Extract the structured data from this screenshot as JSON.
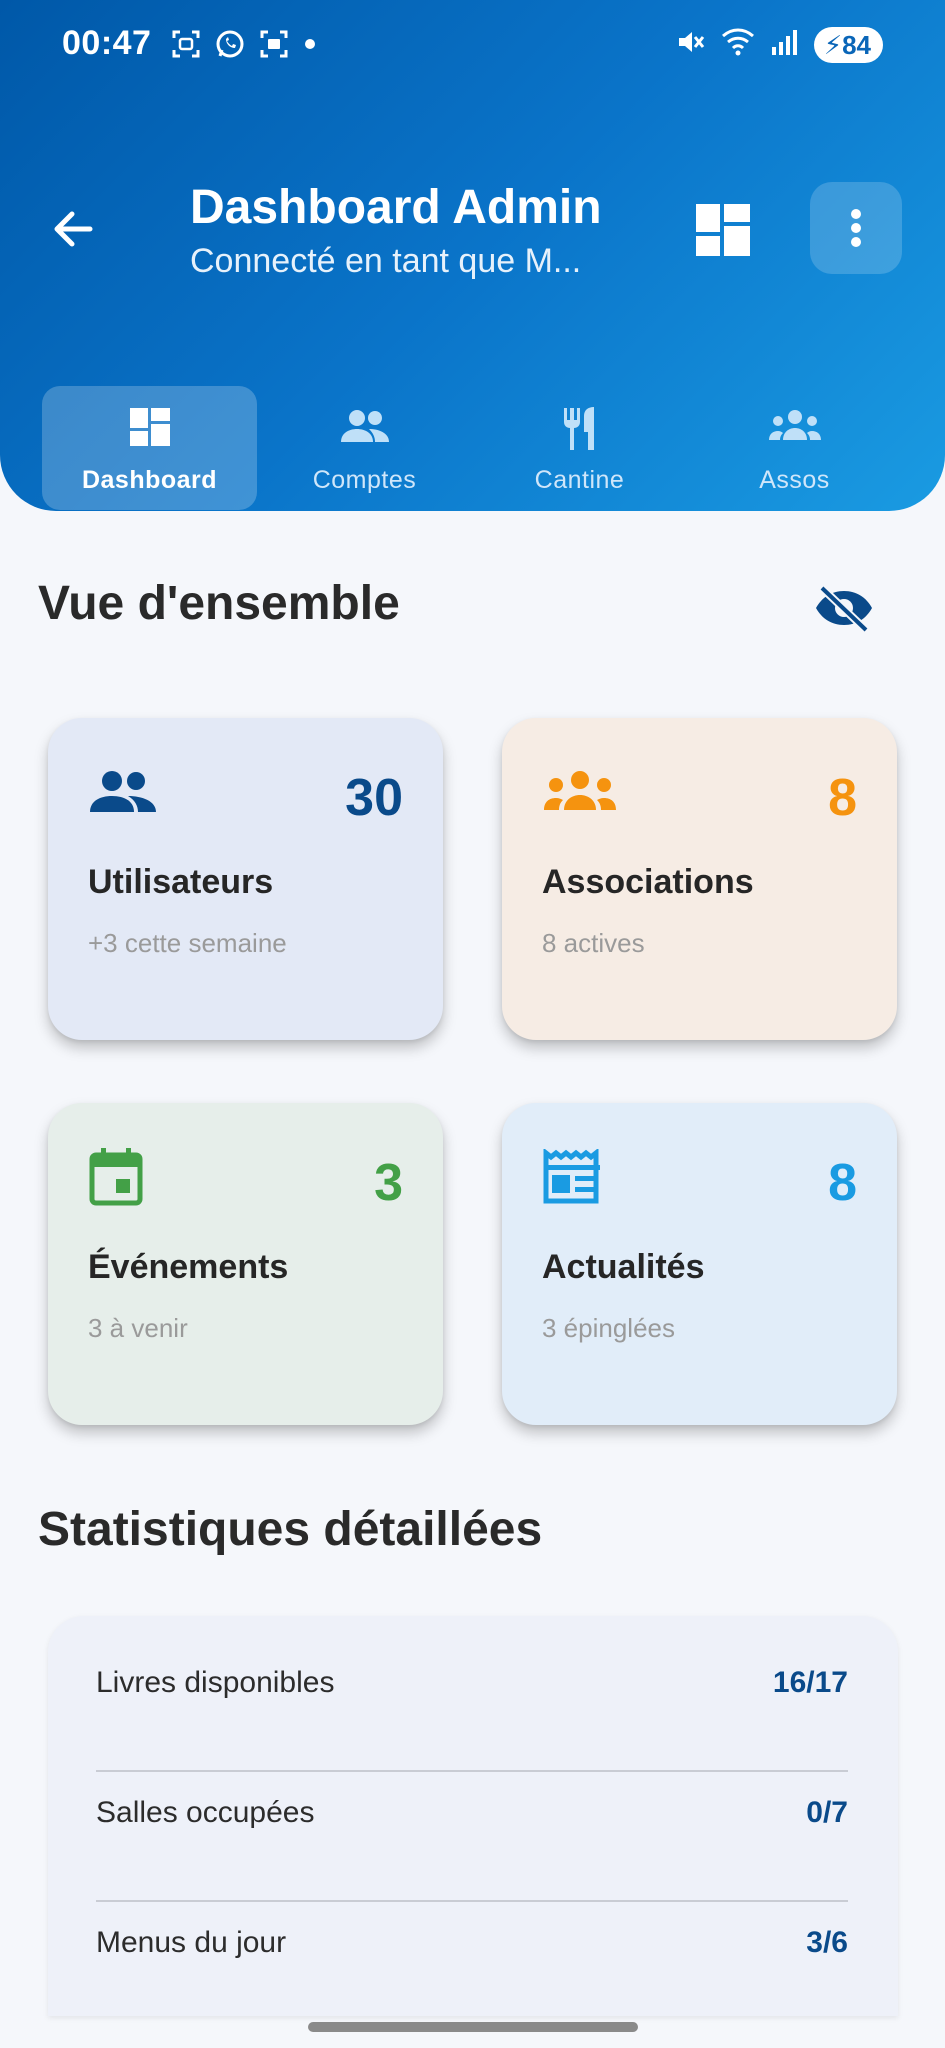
{
  "status_bar": {
    "time": "00:47",
    "battery": "84",
    "icons": [
      "screenshot-icon",
      "whatsapp-icon",
      "scan-icon",
      "dot-icon",
      "mute-icon",
      "wifi-icon",
      "signal-icon",
      "battery-icon"
    ]
  },
  "header": {
    "title": "Dashboard Admin",
    "subtitle": "Connecté en tant que M...",
    "gradient": [
      "#0058a8",
      "#1a9be2"
    ]
  },
  "tabs": [
    {
      "label": "Dashboard",
      "icon": "dashboard-icon",
      "active": true
    },
    {
      "label": "Comptes",
      "icon": "people-icon",
      "active": false
    },
    {
      "label": "Cantine",
      "icon": "restaurant-icon",
      "active": false
    },
    {
      "label": "Assos",
      "icon": "groups-icon",
      "active": false
    }
  ],
  "overview": {
    "title": "Vue d'ensemble",
    "toggle_icon": "visibility-off-icon",
    "cards": [
      {
        "label": "Utilisateurs",
        "value": "30",
        "sub": "+3 cette semaine",
        "icon": "people-icon",
        "color": "#0a4a8a",
        "bg": "#e3e9f6"
      },
      {
        "label": "Associations",
        "value": "8",
        "sub": "8 actives",
        "icon": "groups-icon",
        "color": "#f5930f",
        "bg": "#f6ece4"
      },
      {
        "label": "Événements",
        "value": "3",
        "sub": "3 à venir",
        "icon": "calendar-icon",
        "color": "#43a047",
        "bg": "#e6eeea"
      },
      {
        "label": "Actualités",
        "value": "8",
        "sub": "3 épinglées",
        "icon": "newspaper-icon",
        "color": "#1a9be2",
        "bg": "#e1edf9"
      }
    ]
  },
  "stats": {
    "title": "Statistiques détaillées",
    "rows": [
      {
        "label": "Livres disponibles",
        "value": "16/17"
      },
      {
        "label": "Salles occupées",
        "value": "0/7"
      },
      {
        "label": "Menus du jour",
        "value": "3/6"
      }
    ]
  }
}
